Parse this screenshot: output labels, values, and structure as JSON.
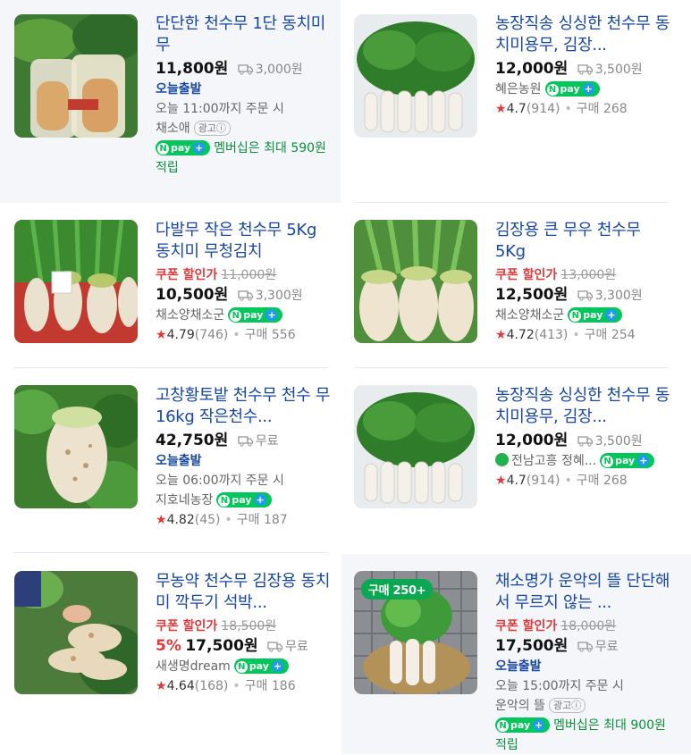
{
  "common": {
    "won": "원",
    "today_ship": "오늘출발",
    "order_suffix": "까지 주문 시",
    "ad": "광고ⓘ",
    "npay": "pay",
    "member_text": "멤버십은 최대",
    "coupon": "쿠폰 할인가",
    "buy": "구매",
    "free": "무료"
  },
  "products": [
    {
      "title": "단단한 천수무 1단 동치미 무",
      "price": "11,800",
      "shipping": "3,000원",
      "order_time": "오늘 11:00",
      "seller": "채소애",
      "member_points": "590원",
      "member_tail": "적립"
    },
    {
      "title": "농장직송 싱싱한 천수무 동치미용무, 김장...",
      "price": "12,000",
      "shipping": "3,500원",
      "seller": "혜은농원",
      "rating": "4.7",
      "reviews": "(914)",
      "purchases": "268"
    },
    {
      "title": "다발무 작은 천수무 5Kg 동치미 무청김치",
      "original_price": "11,000원",
      "price": "10,500",
      "shipping": "3,300원",
      "seller": "채소양채소군",
      "rating": "4.79",
      "reviews": "(746)",
      "purchases": "556"
    },
    {
      "title": "김장용 큰 무우 천수무 5Kg",
      "original_price": "13,000원",
      "price": "12,500",
      "shipping": "3,300원",
      "seller": "채소양채소군",
      "rating": "4.72",
      "reviews": "(413)",
      "purchases": "254"
    },
    {
      "title": "고창황토밭 천수무 천수 무 16kg 작은천수...",
      "price": "42,750",
      "order_time": "오늘 06:00",
      "seller": "지호네농장",
      "rating": "4.82",
      "reviews": "(45)",
      "purchases": "187"
    },
    {
      "title": "농장직송 싱싱한 천수무 동치미용무, 김장...",
      "price": "12,000",
      "shipping": "3,500원",
      "seller": "전남고흥 정혜...",
      "rating": "4.7",
      "reviews": "(914)",
      "purchases": "268"
    },
    {
      "title": "무농약 천수무 김장용 동치미 깍두기 석박...",
      "original_price": "18,500원",
      "discount": "5%",
      "price": "17,500",
      "seller": "새생명dream",
      "rating": "4.64",
      "reviews": "(168)",
      "purchases": "186"
    },
    {
      "title": "채소명가 운악의 뜰 단단해서 무르지 않는 ...",
      "original_price": "18,000원",
      "price": "17,500",
      "order_time": "오늘 15:00",
      "seller": "운악의 뜰",
      "member_points": "900원",
      "member_tail": "적립",
      "badge": "구매 250+"
    }
  ],
  "colors": {
    "link_blue": "#1747a6",
    "coupon_red": "#e2383a",
    "npay_green": "#03c75a",
    "ad_bg": "#f4f6fa"
  }
}
